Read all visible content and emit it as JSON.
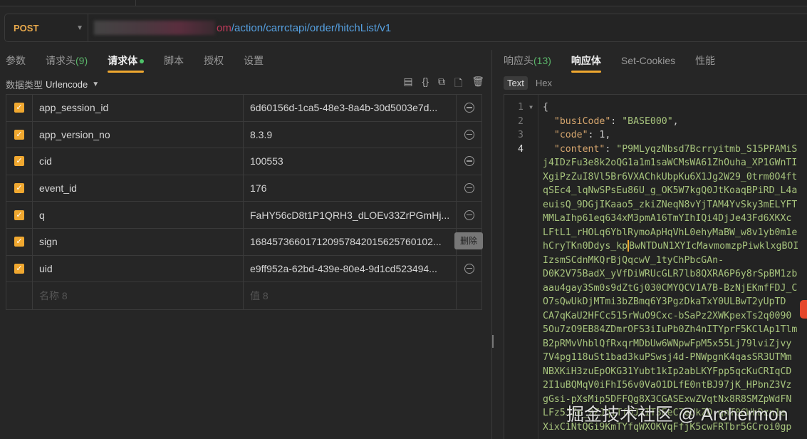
{
  "request": {
    "method": "POST",
    "url_host_suffix": "om",
    "url_path": "/action/carrctapi/order/hitchList/v1"
  },
  "request_tabs": [
    {
      "label": "参数"
    },
    {
      "label": "请求头",
      "count": "(9)"
    },
    {
      "label": "请求体",
      "active": true
    },
    {
      "label": "脚本"
    },
    {
      "label": "授权"
    },
    {
      "label": "设置"
    }
  ],
  "body_type": {
    "label": "数据类型",
    "value": "Urlencode"
  },
  "params": [
    {
      "name": "app_session_id",
      "value": "6d60156d-1ca5-48e3-8a4b-30d5003e7d...",
      "checked": true
    },
    {
      "name": "app_version_no",
      "value": "8.3.9",
      "checked": true
    },
    {
      "name": "cid",
      "value": "100553",
      "checked": true
    },
    {
      "name": "event_id",
      "value": "176",
      "checked": true
    },
    {
      "name": "q",
      "value": "FaHY56cD8t1P1QRH3_dLOEv33ZrPGmHj...",
      "checked": true
    },
    {
      "name": "sign",
      "value": "16845736601712095784201562576010​2...",
      "checked": true
    },
    {
      "name": "uid",
      "value": "e9ff952a-62bd-439e-80e4-9d1cd523494...",
      "checked": true
    }
  ],
  "new_row": {
    "name_placeholder": "名称 8",
    "value_placeholder": "值 8"
  },
  "tooltip": "删除",
  "response_tabs": [
    {
      "label": "响应头",
      "count": "(13)"
    },
    {
      "label": "响应体",
      "active": true
    },
    {
      "label": "Set-Cookies"
    },
    {
      "label": "性能"
    }
  ],
  "format_tabs": [
    "Text",
    "Hex"
  ],
  "response": {
    "busiCode_key": "\"busiCode\"",
    "busiCode_val": "\"BASE000\"",
    "code_key": "\"code\"",
    "code_val": "1",
    "content_key": "\"content\"",
    "content_lines": [
      "\"P9MLyqzNbsd7Bcrryitmb_S15PPAMiS",
      "j4IDzFu3e8k2oQG1a1m1saWCMsWA61ZhOuha_XP1GWnTI",
      "XgiPzZuI8Vl5Br6VXAChkUbpKu6X1Jg2W29_0trm0O4ft",
      "qSEc4_lqNwSPsEu86U_g_OK5W7kgQ0JtKoaqBPiRD_L4a",
      "euisQ_9DGjIKaao5_zkiZNeqN8vYjTAM4YvSky3mELYFT",
      "MMLaIhp61eq634xM3pmA16TmYIhIQi4DjJe43Fd6XKXc",
      "LFtL1_rHOLq6YblRymoApHqVhL0ehyMaBW_w8v1yb0m1e",
      "hCryTKn0Ddys_kp",
      "IzsmSCdnMKQrBjQqcwV_1tyChPbcGAn-",
      "D0K2V75BadX_yVfDiWRUcGLR7lb8QXRA6P6y8rSpBM1zb",
      "aau4gay3Sm0s9dZtGj030CMYQCV1A7B-BzNjEKmfFDJ_C",
      "O7sQwUkDjMTmi3bZBmq6Y3PgzDkaTxY0ULBwT2yUpTD",
      "CA7qKaU2HFCc515rWuO9Cxc-bSaPz2XWKpexTs2q0090",
      "5Ou7zO9EB84ZDmrOFS3iIuPb0Zh4nITYprF5KClAp1Tlm",
      "B2pRMvVhblQfRxqrMDbUw6WNpwFpM5x55Lj79lviZjvy",
      "7V4pg118uSt1bad3kuPSwsj4d-PNWpgnK4qasSR3UTMm",
      "NBXKiH3zuEpOKG31Yubt1kIp2abLKYFpp5qcKuCRIqCD",
      "2I1uBQMqV0iFhI56v0VaO1DLfE0ntBJ97jK_HPbnZ3Vz",
      "gGsi-pXsMip5DFFQg8X3CGASExwZVqtNx8R8SMZpWdFN",
      "LFz5JZm_2ZJqiTfOJ3IT3EeC7eUkZO-gnT0GWhDzn1e",
      "XixC1NtQGi9KmTYfqWXOKVqFfjK5cwFRTbr5GCroi0gp"
    ],
    "cursor_line_rest": "BwNTDuN1XYIcMavmomzpPiwklxgBOI"
  },
  "watermark": "掘金技术社区 @ Archermon",
  "colors": {
    "accent": "#f0a830",
    "method": "#e8a94c",
    "url": "#56a0e0",
    "json_key": "#d6a66e",
    "json_string": "#a7c47d",
    "count": "#5bb56a"
  }
}
